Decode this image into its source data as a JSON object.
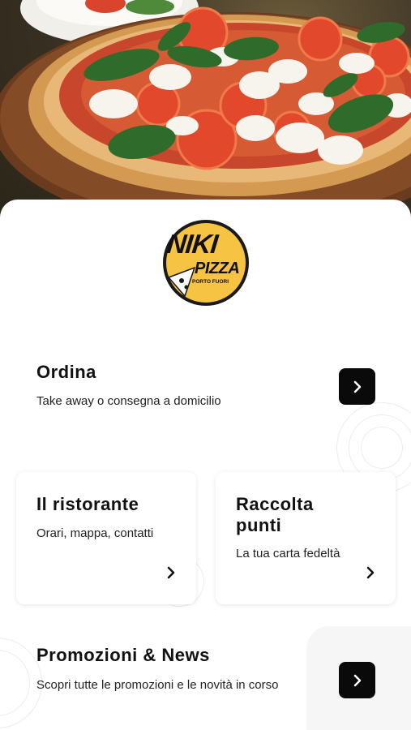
{
  "logo": {
    "brand_line1": "NIKI",
    "brand_line2": "PIZZA",
    "tagline": "PORTO FUORI"
  },
  "ordina": {
    "title": "Ordina",
    "subtitle": "Take away o consegna a domicilio",
    "action_icon": "chevron-right-icon"
  },
  "ristorante": {
    "title": "Il ristorante",
    "subtitle": "Orari, mappa, contatti",
    "action_icon": "chevron-right-icon"
  },
  "raccolta": {
    "title": "Raccolta punti",
    "subtitle": "La tua carta fedeltà",
    "action_icon": "chevron-right-icon"
  },
  "promozioni": {
    "title": "Promozioni & News",
    "subtitle": "Scopri tutte le promozioni e le novità in corso",
    "action_icon": "chevron-right-icon"
  },
  "colors": {
    "logo_yellow": "#f6c343",
    "button_dark": "#0a0a0a",
    "text": "#111111"
  }
}
